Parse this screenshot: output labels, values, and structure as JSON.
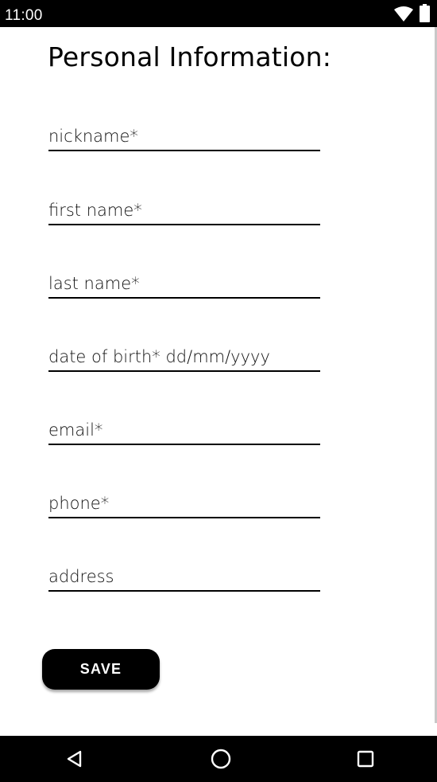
{
  "status_bar": {
    "time": "11:00",
    "icons": [
      "wifi-icon",
      "battery-icon"
    ]
  },
  "form": {
    "title": "Personal Information:",
    "fields": [
      {
        "name": "nickname",
        "placeholder": "nickname*",
        "value": ""
      },
      {
        "name": "first-name",
        "placeholder": "first name*",
        "value": ""
      },
      {
        "name": "last-name",
        "placeholder": "last name*",
        "value": ""
      },
      {
        "name": "date-of-birth",
        "placeholder": "date of birth* dd/mm/yyyy",
        "value": ""
      },
      {
        "name": "email",
        "placeholder": "email*",
        "value": ""
      },
      {
        "name": "phone",
        "placeholder": "phone*",
        "value": ""
      },
      {
        "name": "address",
        "placeholder": "address",
        "value": ""
      }
    ],
    "save_label": "SAVE"
  },
  "nav_bar": {
    "icons": [
      "back-icon",
      "home-icon",
      "recents-icon"
    ]
  },
  "colors": {
    "background": "#ffffff",
    "bars": "#000000",
    "button": "#000000",
    "button_text": "#ffffff"
  }
}
